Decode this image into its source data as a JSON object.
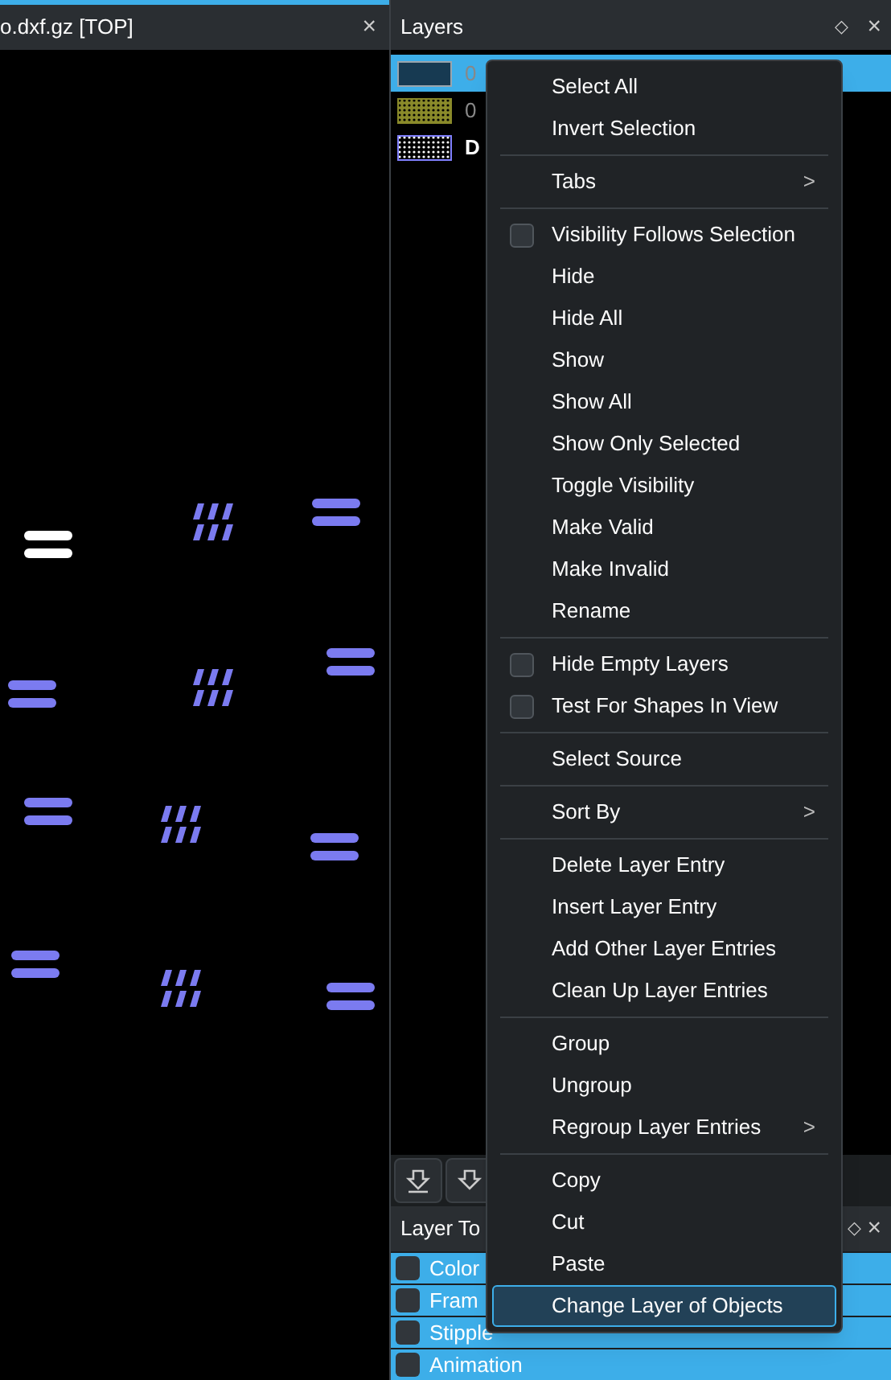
{
  "editor_tab": {
    "title": "o.dxf.gz [TOP]",
    "close": "×"
  },
  "layers_panel": {
    "title": "Layers",
    "float": "◇",
    "close": "×",
    "layers": [
      {
        "name": "0",
        "selected": true,
        "color": "#173a52"
      },
      {
        "name": "0",
        "selected": false,
        "color": "#8a8a2a"
      },
      {
        "name": "D",
        "selected": false,
        "color": "#8080ff"
      }
    ]
  },
  "layer_toolbox": {
    "title": "Layer To",
    "float": "◇",
    "close": "×",
    "sections": [
      {
        "label": "Color"
      },
      {
        "label": "Fram"
      },
      {
        "label": "Stipple"
      },
      {
        "label": "Animation"
      }
    ]
  },
  "context_menu": {
    "items": [
      {
        "kind": "item",
        "label": "Select All",
        "selected": false
      },
      {
        "kind": "item",
        "label": "Invert Selection",
        "selected": false
      },
      {
        "kind": "separator"
      },
      {
        "kind": "submenu",
        "label": "Tabs",
        "arrow": ">",
        "selected": false
      },
      {
        "kind": "separator"
      },
      {
        "kind": "checkbox",
        "label": "Visibility Follows Selection",
        "checked": false,
        "selected": false
      },
      {
        "kind": "item",
        "label": "Hide",
        "selected": false
      },
      {
        "kind": "item",
        "label": "Hide All",
        "selected": false
      },
      {
        "kind": "item",
        "label": "Show",
        "selected": false
      },
      {
        "kind": "item",
        "label": "Show All",
        "selected": false
      },
      {
        "kind": "item",
        "label": "Show Only Selected",
        "selected": false
      },
      {
        "kind": "item",
        "label": "Toggle Visibility",
        "selected": false
      },
      {
        "kind": "item",
        "label": "Make Valid",
        "selected": false
      },
      {
        "kind": "item",
        "label": "Make Invalid",
        "selected": false
      },
      {
        "kind": "item",
        "label": "Rename",
        "selected": false
      },
      {
        "kind": "separator"
      },
      {
        "kind": "checkbox",
        "label": "Hide Empty Layers",
        "checked": false,
        "selected": false
      },
      {
        "kind": "checkbox",
        "label": "Test For Shapes In View",
        "checked": false,
        "selected": false
      },
      {
        "kind": "separator"
      },
      {
        "kind": "item",
        "label": "Select Source",
        "selected": false
      },
      {
        "kind": "separator"
      },
      {
        "kind": "submenu",
        "label": "Sort By",
        "arrow": ">",
        "selected": false
      },
      {
        "kind": "separator"
      },
      {
        "kind": "item",
        "label": "Delete Layer Entry",
        "selected": false
      },
      {
        "kind": "item",
        "label": "Insert Layer Entry",
        "selected": false
      },
      {
        "kind": "item",
        "label": "Add Other Layer Entries",
        "selected": false
      },
      {
        "kind": "item",
        "label": "Clean Up Layer Entries",
        "selected": false
      },
      {
        "kind": "separator"
      },
      {
        "kind": "item",
        "label": "Group",
        "selected": false
      },
      {
        "kind": "item",
        "label": "Ungroup",
        "selected": false
      },
      {
        "kind": "submenu",
        "label": "Regroup Layer Entries",
        "arrow": ">",
        "selected": false
      },
      {
        "kind": "separator"
      },
      {
        "kind": "item",
        "label": "Copy",
        "selected": false
      },
      {
        "kind": "item",
        "label": "Cut",
        "selected": false
      },
      {
        "kind": "item",
        "label": "Paste",
        "selected": false
      },
      {
        "kind": "item",
        "label": "Change Layer of Objects",
        "selected": true
      }
    ]
  }
}
